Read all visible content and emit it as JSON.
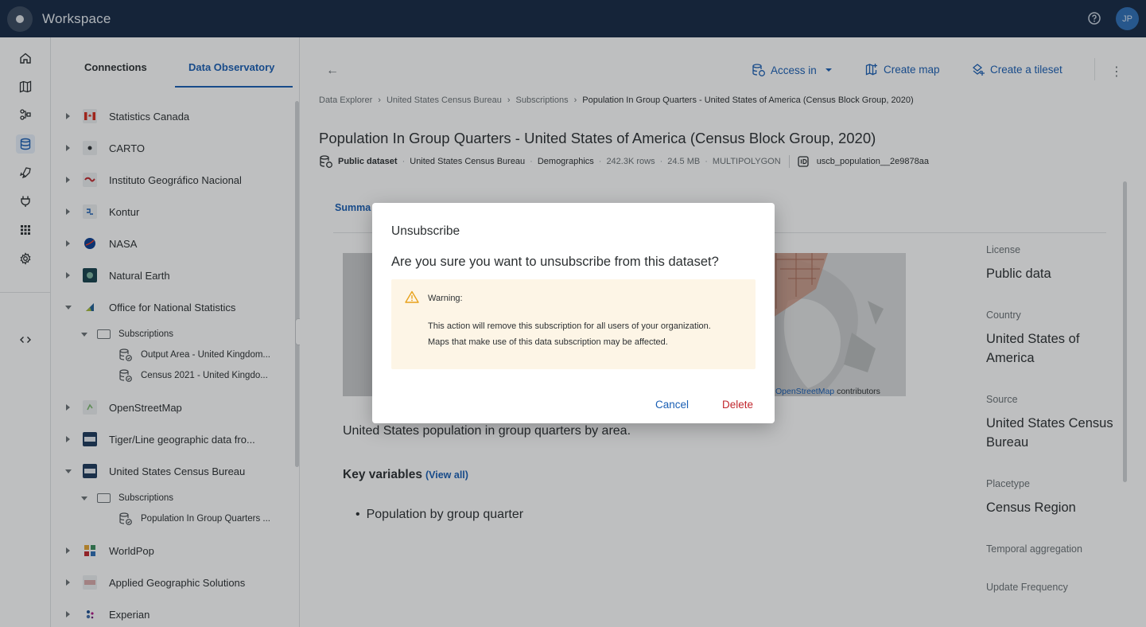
{
  "app": {
    "title": "Workspace",
    "user_initials": "JP"
  },
  "sidebar": {
    "tabs": [
      {
        "label": "Connections"
      },
      {
        "label": "Data Observatory"
      }
    ],
    "providers": [
      {
        "label": "Statistics Canada",
        "logo": "flag-canada-icon"
      },
      {
        "label": "CARTO",
        "logo": "carto-logo-icon"
      },
      {
        "label": "Instituto Geográfico Nacional",
        "logo": "ign-logo-icon"
      },
      {
        "label": "Kontur",
        "logo": "kontur-logo-icon"
      },
      {
        "label": "NASA",
        "logo": "nasa-logo-icon"
      },
      {
        "label": "Natural Earth",
        "logo": "natural-earth-logo-icon"
      },
      {
        "label": "Office for National Statistics",
        "logo": "ons-logo-icon",
        "subscriptions_label": "Subscriptions",
        "datasets": [
          {
            "label": "Output Area - United Kingdom..."
          },
          {
            "label": "Census 2021 - United Kingdo..."
          }
        ]
      },
      {
        "label": "OpenStreetMap",
        "logo": "osm-logo-icon"
      },
      {
        "label": "Tiger/Line geographic data fro...",
        "logo": "census-logo-icon"
      },
      {
        "label": "United States Census Bureau",
        "logo": "census-logo-icon",
        "subscriptions_label": "Subscriptions",
        "datasets": [
          {
            "label": "Population In Group Quarters ..."
          }
        ]
      },
      {
        "label": "WorldPop",
        "logo": "worldpop-logo-icon"
      },
      {
        "label": "Applied Geographic Solutions",
        "logo": "ags-logo-icon"
      },
      {
        "label": "Experian",
        "logo": "experian-logo-icon"
      }
    ]
  },
  "toolbar": {
    "access_in": "Access in",
    "create_map": "Create map",
    "create_tileset": "Create a tileset"
  },
  "breadcrumb": [
    "Data Explorer",
    "United States Census Bureau",
    "Subscriptions",
    "Population In Group Quarters - United States of America (Census Block Group, 2020)"
  ],
  "dataset": {
    "title": "Population In Group Quarters - United States of America (Census Block Group, 2020)",
    "type": "Public dataset",
    "provider": "United States Census Bureau",
    "category": "Demographics",
    "rows": "242.3K rows",
    "size": "24.5 MB",
    "geometry": "MULTIPOLYGON",
    "id": "uscb_population__2e9878aa",
    "summary_tab": "Summa",
    "map_attr_link": "OpenStreetMap",
    "map_attr_text": "contributors",
    "description": "United States population in group quarters by area.",
    "key_variables_title": "Key variables",
    "view_all": "(View all)",
    "key_variables": [
      "Population by group quarter"
    ]
  },
  "details": [
    {
      "label": "License",
      "value": "Public data"
    },
    {
      "label": "Country",
      "value": "United States of America"
    },
    {
      "label": "Source",
      "value": "United States Census Bureau"
    },
    {
      "label": "Placetype",
      "value": "Census Region"
    },
    {
      "label": "Temporal aggregation",
      "value": ""
    },
    {
      "label": "Update Frequency",
      "value": ""
    }
  ],
  "modal": {
    "title": "Unsubscribe",
    "question": "Are you sure you want to unsubscribe from this dataset?",
    "warning_title": "Warning:",
    "warning_line1": "This action will remove this subscription for all users of your organization.",
    "warning_line2": "Maps that make use of this data subscription may be affected.",
    "cancel": "Cancel",
    "delete": "Delete"
  },
  "colors": {
    "topbar": "#162945",
    "accent": "#1a5fb4",
    "danger": "#c1272d",
    "warning_bg": "#fdf5e6",
    "warning_icon": "#e8a21c"
  }
}
